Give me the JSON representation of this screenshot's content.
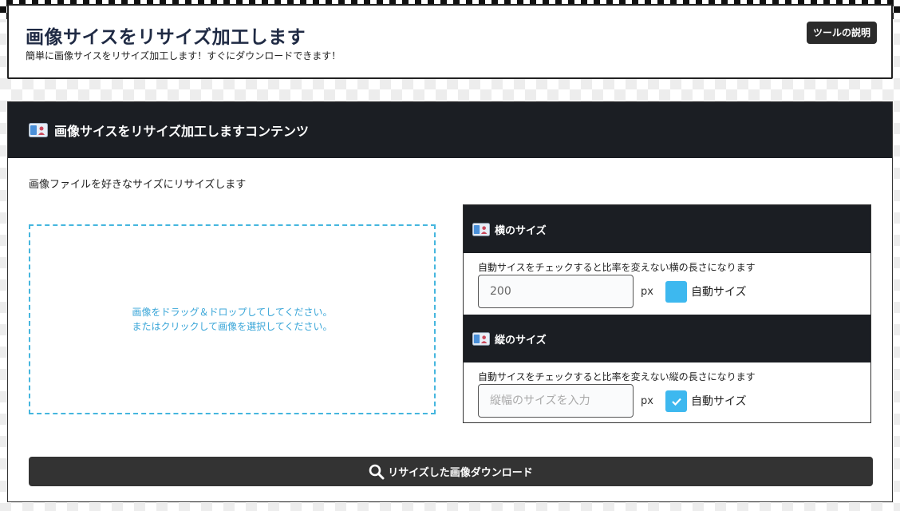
{
  "header": {
    "title": "画像サイスをリサイズ加工します",
    "subtitle": "簡単に画像サイスをリサイズ加工します！すぐにダウンロードできます！",
    "help_button": "ツールの説明"
  },
  "panel": {
    "title": "画像サイスをリサイズ加工しますコンテンツ",
    "description": "画像ファイルを好きなサイズにリサイズします",
    "dropzone": {
      "line1": "画像をドラッグ＆ドロップしてしてください。",
      "line2": "またはクリックして画像を選択してください。"
    },
    "width": {
      "title": "横のサイズ",
      "note": "自動サイスをチェックすると比率を変えない横の長さになります",
      "value": "200",
      "placeholder": "",
      "unit": "px",
      "auto_label": "自動サイズ",
      "auto_checked": false
    },
    "height": {
      "title": "縦のサイズ",
      "note": "自動サイスをチェックすると比率を変えない縦の長さになります",
      "value": "",
      "placeholder": "縦幅のサイズを入力",
      "unit": "px",
      "auto_label": "自動サイズ",
      "auto_checked": true
    },
    "download_button": "リサイズした画像ダウンロード"
  },
  "colors": {
    "accent": "#3db8ef",
    "dark": "#1b1e23",
    "dropzone": "#45b6de"
  }
}
